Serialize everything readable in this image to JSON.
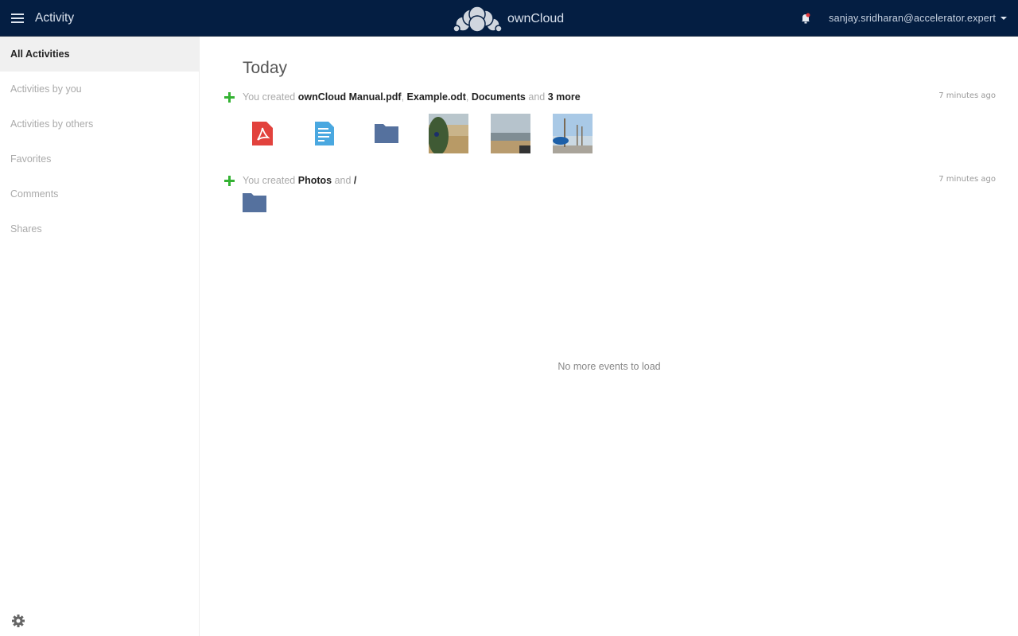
{
  "header": {
    "app_title": "Activity",
    "logo_text": "ownCloud",
    "user": "sanjay.sridharan@accelerator.expert",
    "colors": {
      "bar": "#041e42"
    }
  },
  "sidebar": {
    "items": [
      {
        "label": "All Activities",
        "active": true
      },
      {
        "label": "Activities by you"
      },
      {
        "label": "Activities by others"
      },
      {
        "label": "Favorites"
      },
      {
        "label": "Comments"
      },
      {
        "label": "Shares"
      }
    ],
    "settings_icon": "gear-icon"
  },
  "main": {
    "section_title": "Today",
    "activities": [
      {
        "prefix": "You created ",
        "items": [
          "ownCloud Manual.pdf",
          "Example.odt",
          "Documents"
        ],
        "sep": ", ",
        "and": " and ",
        "more": "3 more",
        "time": "7 minutes ago",
        "previews": [
          "pdf-file-icon",
          "text-file-icon",
          "folder-icon",
          "photo-thumbnail-cactus",
          "photo-thumbnail-beach",
          "photo-thumbnail-pier"
        ]
      },
      {
        "prefix": "You created ",
        "items": [
          "Photos"
        ],
        "and": " and ",
        "more": "/",
        "time": "7 minutes ago",
        "previews": [
          "folder-icon"
        ]
      }
    ],
    "empty_text": "No more events to load"
  }
}
